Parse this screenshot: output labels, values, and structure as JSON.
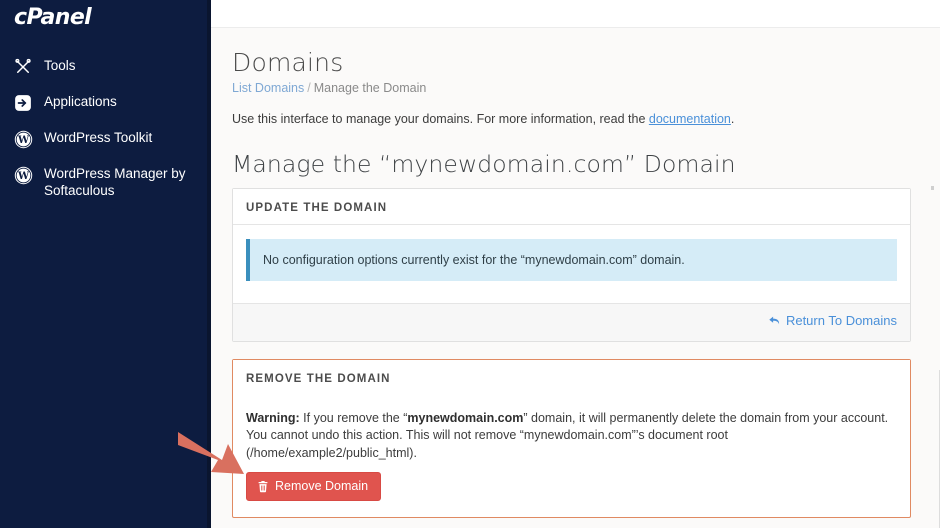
{
  "sidebar": {
    "logo": "cPanel",
    "items": [
      {
        "label": "Tools",
        "icon": "tools-icon"
      },
      {
        "label": "Applications",
        "icon": "applications-icon"
      },
      {
        "label": "WordPress Toolkit",
        "icon": "wordpress-icon"
      },
      {
        "label": "WordPress Manager by Softaculous",
        "icon": "wordpress-icon"
      }
    ]
  },
  "header": {
    "title": "Domains",
    "breadcrumb": {
      "root": "List Domains",
      "separator": "/",
      "current": "Manage the Domain"
    },
    "intro_prefix": "Use this interface to manage your domains. For more information, read the ",
    "intro_link": "documentation",
    "intro_suffix": "."
  },
  "main": {
    "section_title": "Manage the “mynewdomain.com” Domain",
    "update_panel": {
      "title": "UPDATE THE DOMAIN",
      "alert_text": "No configuration options currently exist for the “mynewdomain.com” domain.",
      "footer_link": "Return To Domains",
      "footer_icon": "reply-arrow-icon"
    },
    "remove_panel": {
      "title": "REMOVE THE DOMAIN",
      "warning_label": "Warning:",
      "warning_part1": " If you remove the “",
      "warning_domain": "mynewdomain.com",
      "warning_part2": "” domain, it will permanently delete the domain from your account. You cannot undo this action. This will not remove “mynewdomain.com”’s document root (/home/example2/public_html).",
      "button_label": "Remove Domain",
      "button_icon": "trash-icon"
    }
  },
  "colors": {
    "sidebar_bg": "#0d1c40",
    "accent_link": "#4a90d9",
    "danger": "#e0544e",
    "danger_border": "#e08a62",
    "info_bg": "#d5ecf7",
    "info_border": "#3a8fbd",
    "annotation_arrow": "#d9705f"
  },
  "annotation": {
    "type": "arrow",
    "points_to": "Remove Domain"
  }
}
